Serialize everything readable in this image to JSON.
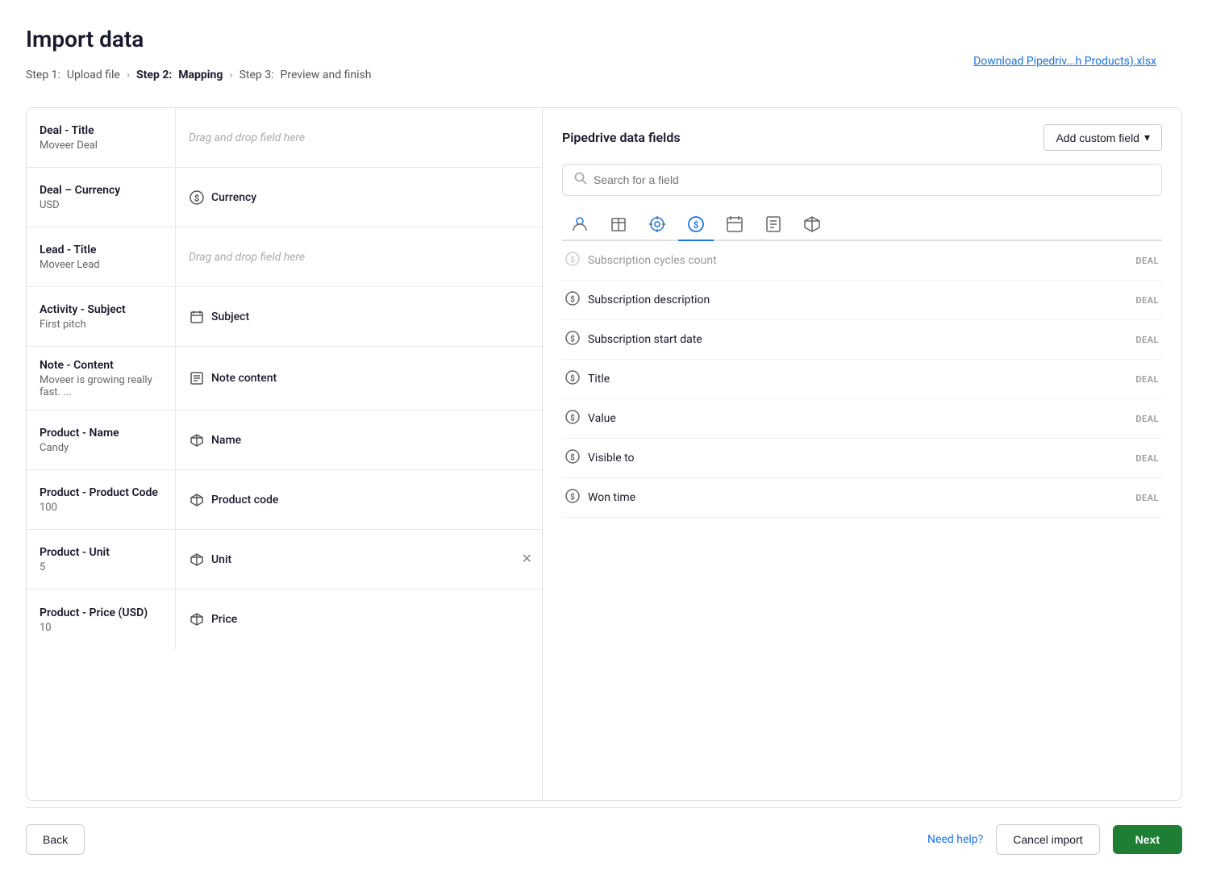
{
  "page": {
    "title": "Import data",
    "download_link": "Download Pipedriv...h Products).xlsx"
  },
  "breadcrumb": {
    "step1_label": "Step 1:",
    "step1_name": "Upload file",
    "step2_label": "Step 2:",
    "step2_name": "Mapping",
    "step3_label": "Step 3:",
    "step3_name": "Preview and finish"
  },
  "left_panel": {
    "rows": [
      {
        "source_title": "Deal - Title",
        "source_value": "Moveer Deal",
        "mapped": false,
        "placeholder": "Drag and drop field here",
        "field_name": "",
        "has_remove": false
      },
      {
        "source_title": "Deal – Currency",
        "source_value": "USD",
        "mapped": true,
        "placeholder": "",
        "field_name": "Currency",
        "field_icon": "dollar",
        "has_remove": false
      },
      {
        "source_title": "Lead - Title",
        "source_value": "Moveer Lead",
        "mapped": false,
        "placeholder": "Drag and drop field here",
        "field_name": "",
        "has_remove": false
      },
      {
        "source_title": "Activity - Subject",
        "source_value": "First pitch",
        "mapped": true,
        "placeholder": "",
        "field_name": "Subject",
        "field_icon": "calendar",
        "has_remove": false
      },
      {
        "source_title": "Note - Content",
        "source_value": "Moveer is growing really fast. ...",
        "mapped": true,
        "placeholder": "",
        "field_name": "Note content",
        "field_icon": "note",
        "has_remove": false
      },
      {
        "source_title": "Product - Name",
        "source_value": "Candy",
        "mapped": true,
        "placeholder": "",
        "field_name": "Name",
        "field_icon": "box",
        "has_remove": false
      },
      {
        "source_title": "Product - Product Code",
        "source_value": "100",
        "mapped": true,
        "placeholder": "",
        "field_name": "Product code",
        "field_icon": "box",
        "has_remove": false
      },
      {
        "source_title": "Product - Unit",
        "source_value": "5",
        "mapped": true,
        "placeholder": "",
        "field_name": "Unit",
        "field_icon": "box",
        "has_remove": true
      },
      {
        "source_title": "Product - Price (USD)",
        "source_value": "10",
        "mapped": true,
        "placeholder": "",
        "field_name": "Price",
        "field_icon": "box",
        "has_remove": false
      }
    ]
  },
  "right_panel": {
    "title": "Pipedrive data fields",
    "add_custom_label": "Add custom field",
    "search_placeholder": "Search for a field",
    "tabs": [
      {
        "icon": "person",
        "active": false
      },
      {
        "icon": "building",
        "active": false
      },
      {
        "icon": "target",
        "active": false
      },
      {
        "icon": "dollar-circle",
        "active": true
      },
      {
        "icon": "calendar-small",
        "active": false
      },
      {
        "icon": "note-small",
        "active": false
      },
      {
        "icon": "box-small",
        "active": false
      }
    ],
    "fields": [
      {
        "name": "Subscription cycles count",
        "tag": "DEAL",
        "muted": true
      },
      {
        "name": "Subscription description",
        "tag": "DEAL",
        "muted": false
      },
      {
        "name": "Subscription start date",
        "tag": "DEAL",
        "muted": false
      },
      {
        "name": "Title",
        "tag": "DEAL",
        "muted": false
      },
      {
        "name": "Value",
        "tag": "DEAL",
        "muted": false
      },
      {
        "name": "Visible to",
        "tag": "DEAL",
        "muted": false
      },
      {
        "name": "Won time",
        "tag": "DEAL",
        "muted": false
      }
    ]
  },
  "footer": {
    "back_label": "Back",
    "need_help_label": "Need help?",
    "cancel_label": "Cancel import",
    "next_label": "Next"
  }
}
